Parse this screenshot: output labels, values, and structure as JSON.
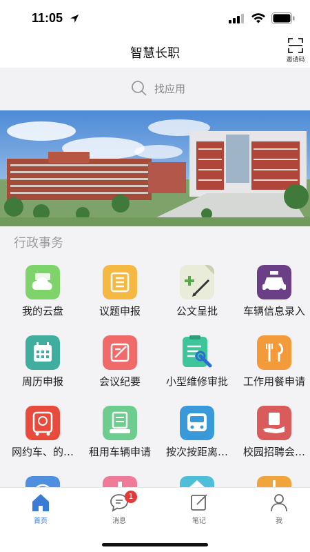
{
  "status_bar": {
    "time": "11:05"
  },
  "nav": {
    "title": "智慧长职",
    "invite_label": "邀请码"
  },
  "search": {
    "placeholder": "找应用"
  },
  "section": {
    "title": "行政事务",
    "apps": [
      {
        "label": "我的云盘",
        "icon": "cloud-disk-icon",
        "color": "#7ed36b"
      },
      {
        "label": "议题申报",
        "icon": "topic-report-icon",
        "color": "#f5b943"
      },
      {
        "label": "公文呈批",
        "icon": "document-approval-icon",
        "color": "#e8ecd9"
      },
      {
        "label": "车辆信息录入",
        "icon": "taxi-icon",
        "color": "#6b3f86"
      },
      {
        "label": "周历申报",
        "icon": "calendar-icon",
        "color": "#3fae9e"
      },
      {
        "label": "会议纪要",
        "icon": "meeting-minutes-icon",
        "color": "#f06a6a"
      },
      {
        "label": "小型维修审批",
        "icon": "repair-approval-icon",
        "color": "#3ec69a"
      },
      {
        "label": "工作用餐申请",
        "icon": "meal-icon",
        "color": "#f39a3b"
      },
      {
        "label": "网约车、的…",
        "icon": "bus-icon",
        "color": "#e84a3c"
      },
      {
        "label": "租用车辆申请",
        "icon": "vehicle-rental-icon",
        "color": "#6dcc8e"
      },
      {
        "label": "按次按距离…",
        "icon": "bus-distance-icon",
        "color": "#3a9ad9"
      },
      {
        "label": "校园招聘会…",
        "icon": "recruitment-icon",
        "color": "#d95b5b"
      }
    ],
    "partial_icon_colors": [
      "#4f8fe0",
      "#f07a9a",
      "#4fbfd9",
      "#f0a43b"
    ]
  },
  "tabs": [
    {
      "label": "首页",
      "icon": "home-icon",
      "active": true
    },
    {
      "label": "消息",
      "icon": "message-icon",
      "badge": "1"
    },
    {
      "label": "笔记",
      "icon": "note-icon"
    },
    {
      "label": "我",
      "icon": "profile-icon"
    }
  ]
}
